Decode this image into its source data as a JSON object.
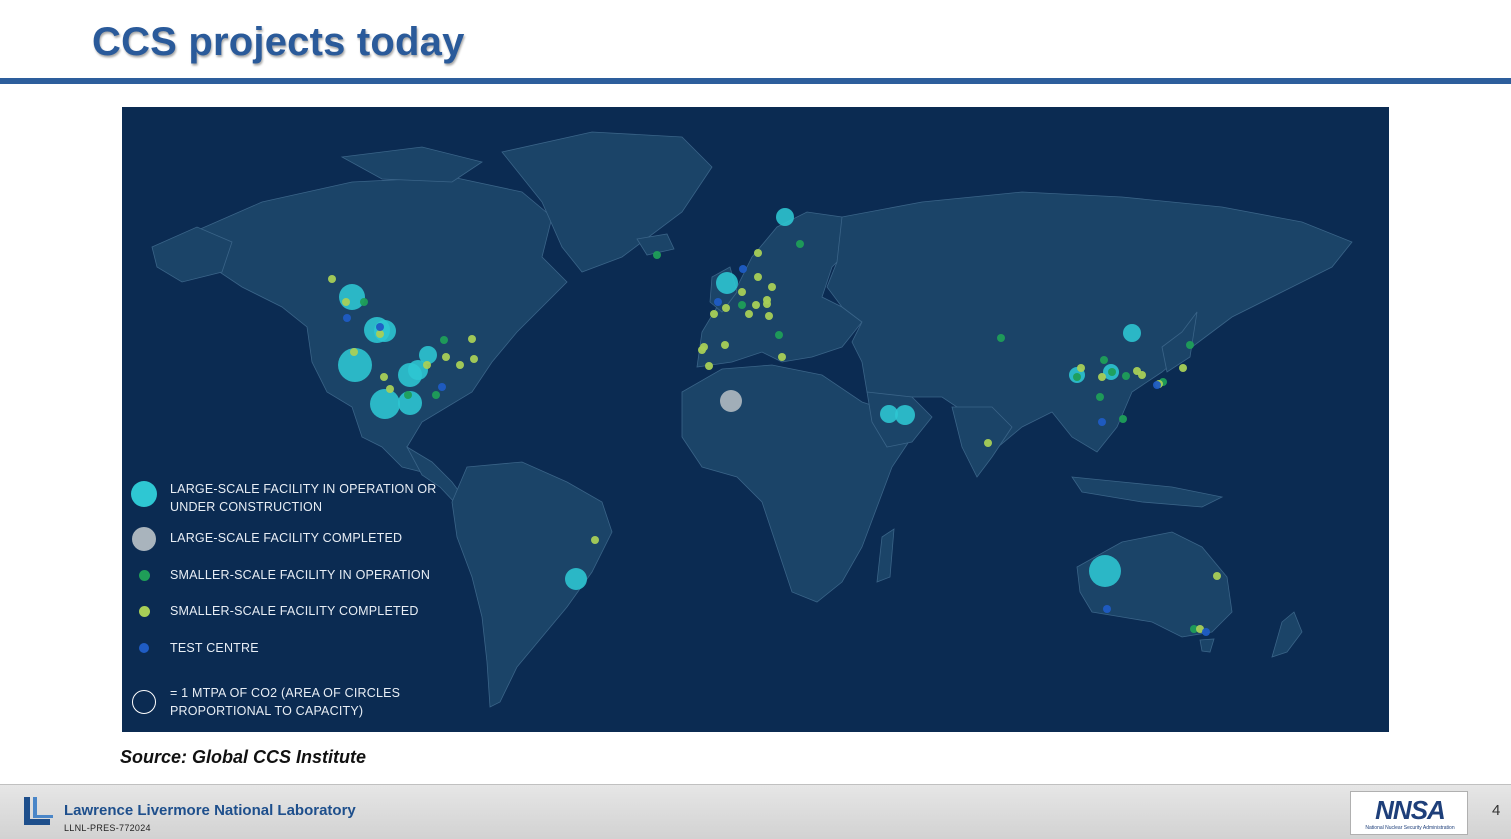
{
  "slide": {
    "title": "CCS projects today",
    "source": "Source: Global CCS Institute",
    "page_number": "4"
  },
  "footer": {
    "lab_name": "Lawrence Livermore National Laboratory",
    "doc_code": "LLNL-PRES-772024",
    "partner_logo": "NNSA",
    "partner_tagline": "National Nuclear Security Administration"
  },
  "map": {
    "background_color": "#0b2b52",
    "land_color": "#1b4468",
    "border_color": "#3a6488",
    "legend": [
      {
        "key": "large_op",
        "label_lines": [
          "LARGE-SCALE FACILITY IN OPERATION OR",
          "UNDER CONSTRUCTION"
        ],
        "color": "#2ec7d3",
        "marker": "large"
      },
      {
        "key": "large_done",
        "label_lines": [
          "LARGE-SCALE FACILITY COMPLETED"
        ],
        "color": "#a9b4bd",
        "marker": "large"
      },
      {
        "key": "small_op",
        "label_lines": [
          "SMALLER-SCALE FACILITY IN OPERATION"
        ],
        "color": "#1f9e58",
        "marker": "small"
      },
      {
        "key": "small_done",
        "label_lines": [
          "SMALLER-SCALE FACILITY COMPLETED"
        ],
        "color": "#a8cf57",
        "marker": "small"
      },
      {
        "key": "test",
        "label_lines": [
          "TEST CENTRE"
        ],
        "color": "#1f5cc4",
        "marker": "small"
      },
      {
        "key": "scale",
        "label_lines": [
          "= 1 MTPA OF CO2 (AREA OF CIRCLES",
          "PROPORTIONAL TO CAPACITY)"
        ],
        "color": "#ffffff",
        "marker": "ring"
      }
    ]
  }
}
